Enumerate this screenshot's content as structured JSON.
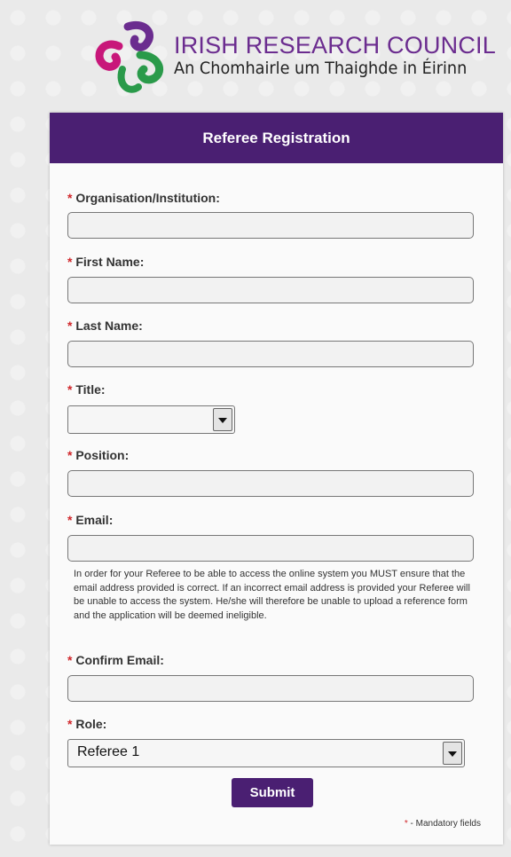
{
  "logo": {
    "title": "IRISH RESEARCH COUNCIL",
    "subtitle": "An Chomhairle um Thaighde in Éirinn",
    "colors": {
      "purple": "#6b2c8f",
      "magenta": "#c8177a",
      "green": "#2a9a4a"
    }
  },
  "form": {
    "header": "Referee Registration",
    "required_marker": "*",
    "fields": {
      "organisation": {
        "label": "Organisation/Institution:",
        "value": ""
      },
      "first_name": {
        "label": "First Name:",
        "value": ""
      },
      "last_name": {
        "label": "Last Name:",
        "value": ""
      },
      "title": {
        "label": "Title:",
        "selected": ""
      },
      "position": {
        "label": "Position:",
        "value": ""
      },
      "email": {
        "label": "Email:",
        "value": ""
      },
      "confirm_email": {
        "label": "Confirm Email:",
        "value": ""
      },
      "role": {
        "label": "Role:",
        "selected": "Referee 1"
      }
    },
    "email_help": "In order for your Referee to be able to access the online system you MUST ensure that the email address provided is correct. If an incorrect email address is provided your Referee will be unable to access the system. He/she will therefore be unable to upload a reference form and the application will be deemed ineligible.",
    "submit_label": "Submit",
    "mandatory_note": " - Mandatory fields"
  },
  "colors": {
    "header_bg": "#4a1f72",
    "required": "#d0262a"
  }
}
